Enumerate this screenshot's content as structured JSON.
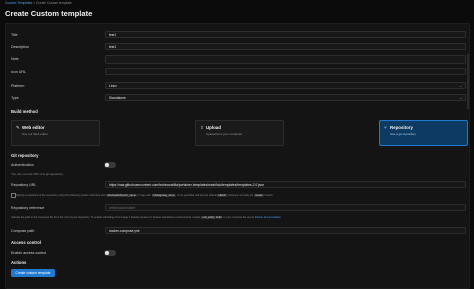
{
  "breadcrumb": {
    "parent": "Custom Templates",
    "sep": " > ",
    "current": "Create Custom template"
  },
  "page_title": "Create Custom template",
  "form": {
    "title": {
      "label": "Title",
      "value": "test1"
    },
    "description": {
      "label": "Description",
      "value": "test1"
    },
    "note": {
      "label": "Note",
      "value": ""
    },
    "icon_url": {
      "label": "Icon URL",
      "value": ""
    },
    "platform": {
      "label": "Platform",
      "value": "Linux"
    },
    "type": {
      "label": "Type",
      "value": "Standalone"
    }
  },
  "build_method": {
    "heading": "Build method",
    "options": [
      {
        "title": "Web editor",
        "subtitle": "Use our Web editor",
        "icon": "edit-icon",
        "selected": false
      },
      {
        "title": "Upload",
        "subtitle": "Upload from your computer",
        "icon": "upload-icon",
        "selected": false
      },
      {
        "title": "Repository",
        "subtitle": "Use a git repository",
        "icon": "git-icon",
        "selected": true
      }
    ]
  },
  "git": {
    "heading": "Git repository",
    "authentication_label": "Authentication",
    "auth_hint": "You can use the URL of a git repository.",
    "repo_url_label": "Repository URL",
    "repo_url_value": "https://raw.githubusercontent.com/technorabilia/portainer-templates/main/lsio/templates/templates-2.0.json",
    "reference_hint_1": "Specify a reference of the repository using the following syntax: branches with",
    "reference_code_1": "refs/heads/branch_name",
    "reference_hint_2": "or tags with",
    "reference_code_2": "refs/tags/tag_name",
    "reference_hint_3": ". If not specified, will use the default",
    "reference_code_3": "HEAD",
    "reference_hint_4": "reference normally the",
    "reference_code_4": "master",
    "reference_hint_5": "branch.",
    "reference_label": "Repository reference",
    "reference_placeholder": "refs/heads/master",
    "compose_hint_1": "Indicate the path to the Compose file from the root of your repository. To enable rebuilding of an image if already present on Docker standalone environments, include",
    "compose_hint_code": "pull_policy: build",
    "compose_hint_2": "in your compose file as per",
    "compose_hint_link": "Docker documentation",
    "compose_label": "Compose path",
    "compose_value": "docker-compose.yml"
  },
  "access": {
    "heading": "Access control",
    "enable_label": "Enable access control"
  },
  "actions": {
    "heading": "Actions",
    "create_button": "Create custom template"
  },
  "colors": {
    "accent": "#1f7ad0",
    "background": "#0b0b0b",
    "panel": "#141414"
  }
}
